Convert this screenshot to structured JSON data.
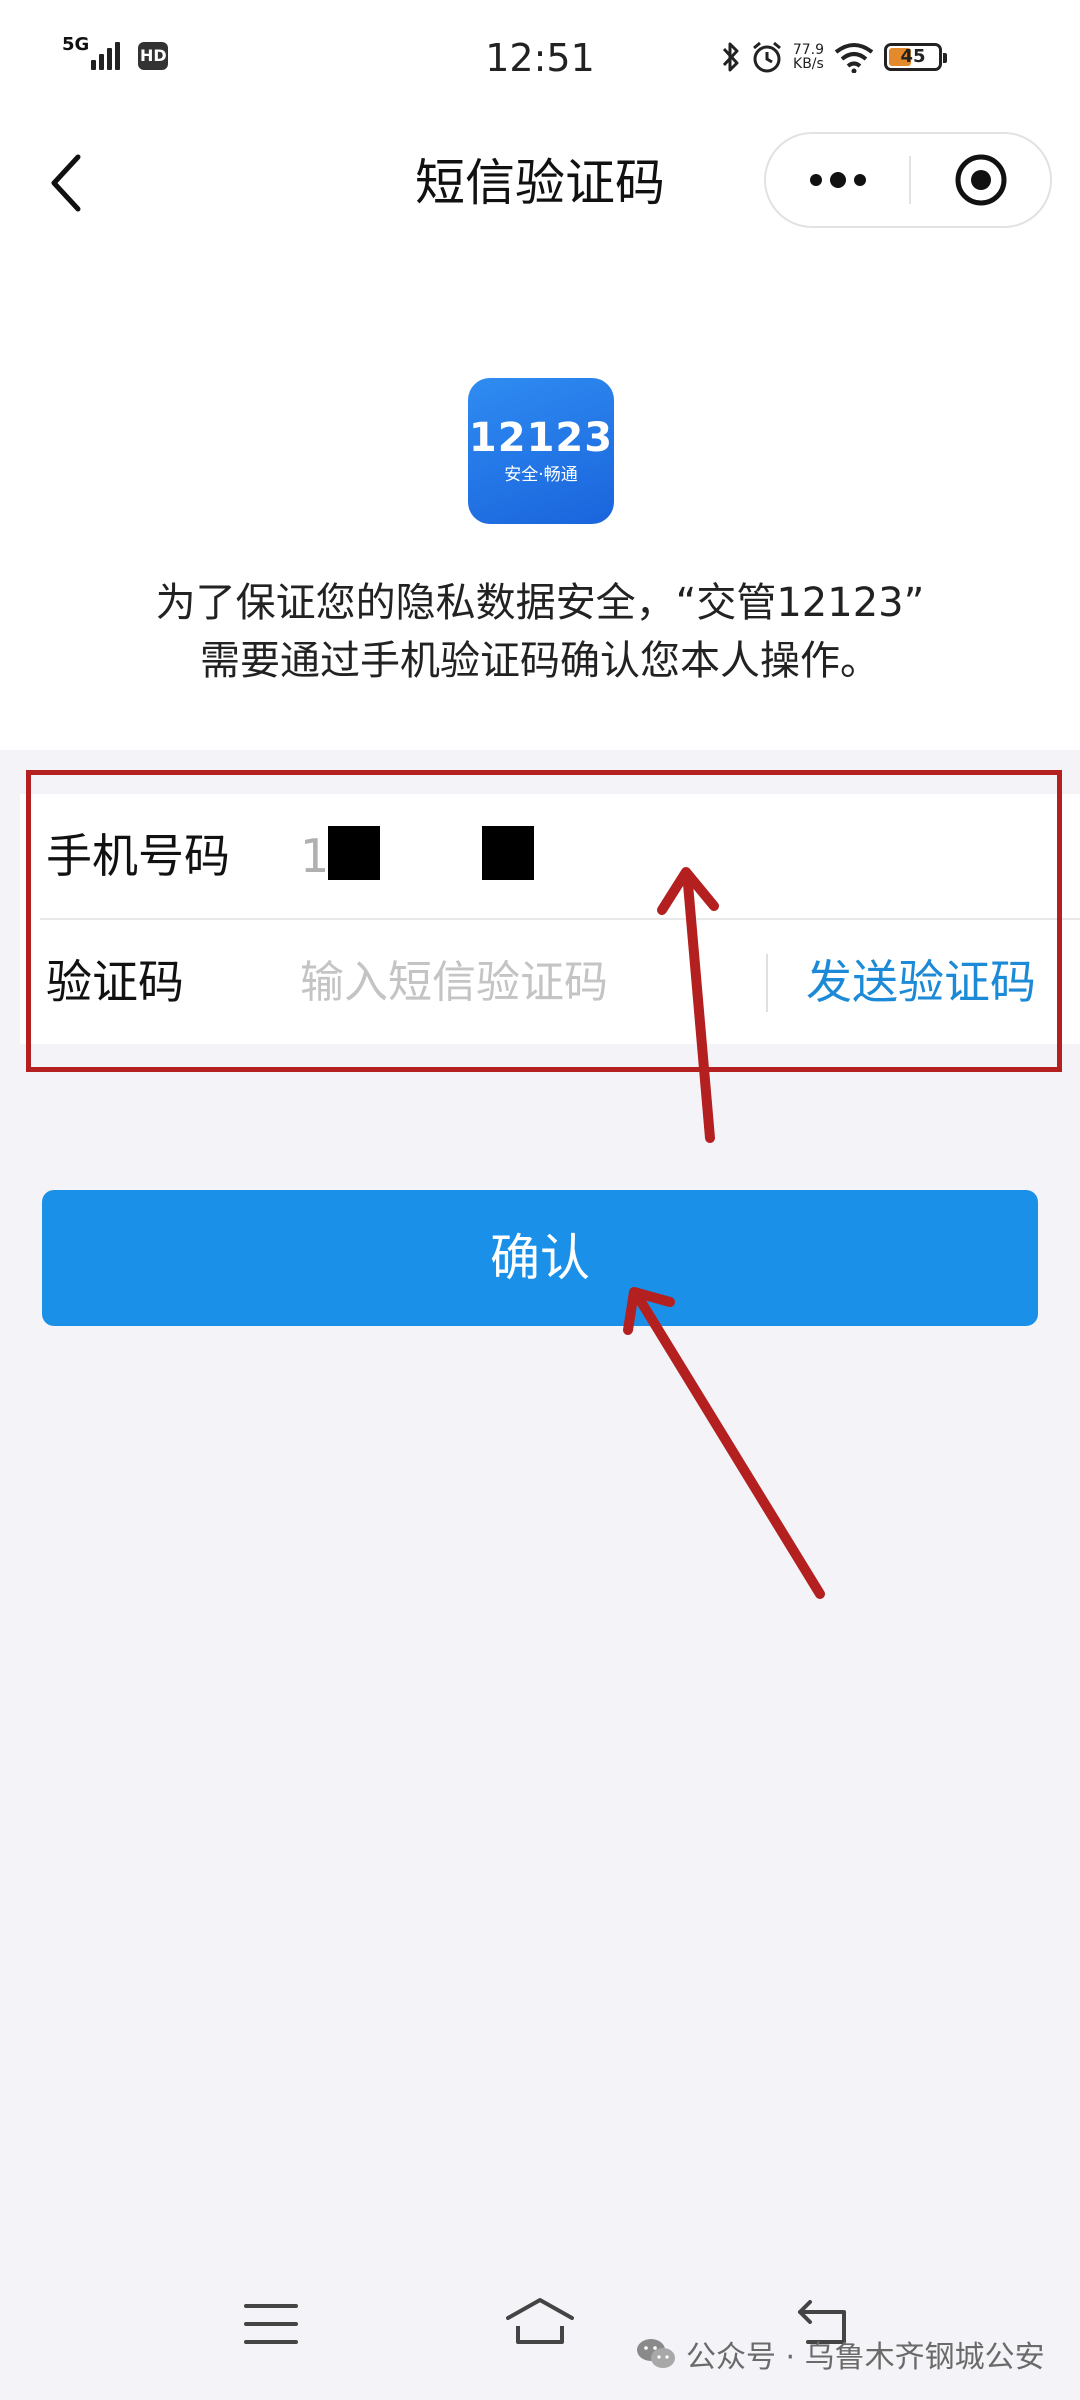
{
  "status_bar": {
    "network": "5G",
    "hd": "HD",
    "time": "12:51",
    "net_speed_value": "77.9",
    "net_speed_unit": "KB/s",
    "battery": "45",
    "battery_level": 0.45
  },
  "nav": {
    "title": "短信验证码"
  },
  "notice": {
    "line1": "为了保证您的隐私数据安全，“交管12123”",
    "line2": "需要通过手机验证码确认您本人操作。"
  },
  "logo": {
    "number": "12123",
    "slogan": "安全·畅通"
  },
  "form": {
    "phone_label": "手机号码",
    "phone_value": "1",
    "code_label": "验证码",
    "code_placeholder": "输入短信验证码",
    "send_code": "发送验证码"
  },
  "confirm_label": "确认",
  "watermark": "公众号 · 乌鲁木齐钢城公安",
  "colors": {
    "primary_button": "#1a90e8",
    "link": "#1c8ad6",
    "annotation": "#b3201f",
    "logo_blue": "#1a64dc"
  }
}
